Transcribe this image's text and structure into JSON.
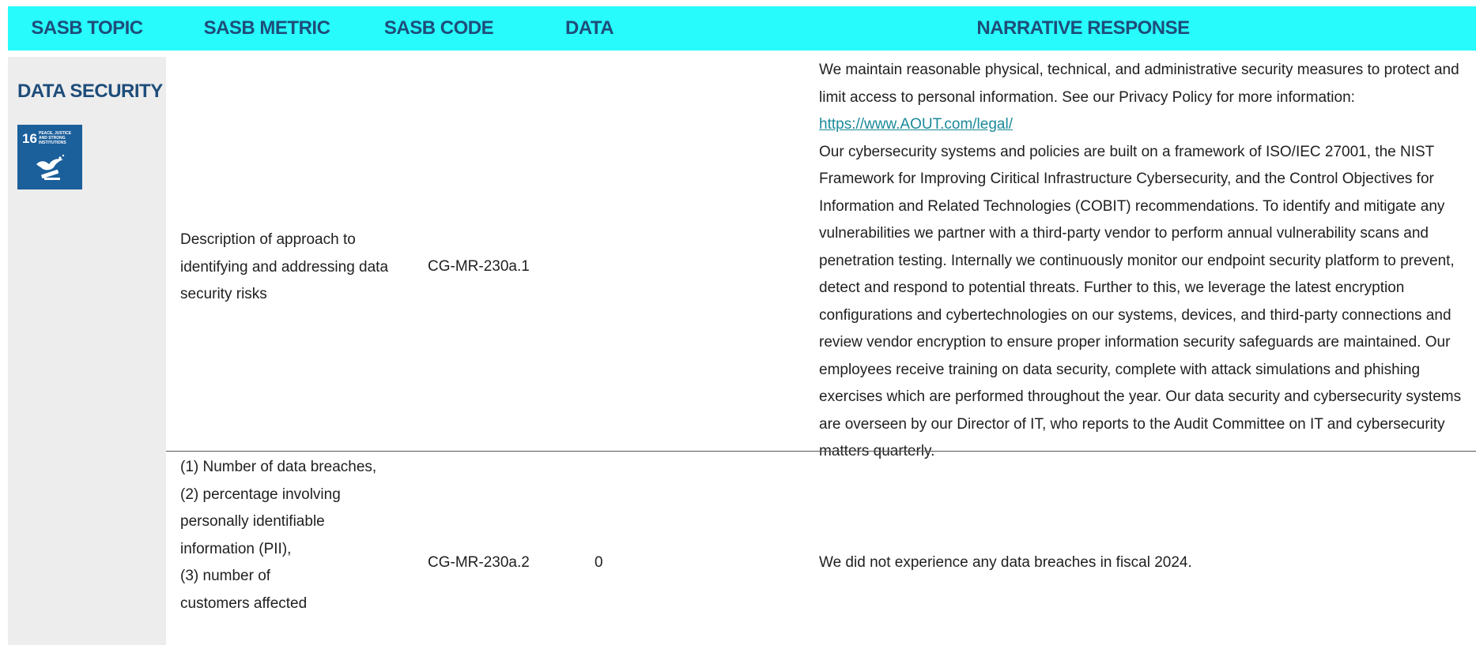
{
  "header": {
    "topic": "SASB TOPIC",
    "metric": "SASB METRIC",
    "code": "SASB CODE",
    "data": "DATA",
    "narrative": "NARRATIVE RESPONSE"
  },
  "topic": {
    "title": "DATA SECURITY",
    "sdg_badge": {
      "number": "16",
      "caption": "PEACE, JUSTICE AND STRONG INSTITUTIONS",
      "icon": "dove-gavel-icon",
      "color": "#1b5f9b"
    }
  },
  "rows": [
    {
      "metric": "Description of approach to identifying and addressing data security risks",
      "code": "CG-MR-230a.1",
      "data": "",
      "narrative_p1": "We maintain reasonable physical, technical, and administrative security measures to protect and limit access to personal information. See our Privacy Policy for more information:",
      "narrative_link": "https://www.AOUT.com/legal/",
      "narrative_p2": "Our cybersecurity systems and policies are built on a framework of ISO/IEC 27001, the NIST Framework for Improving Ciritical Infrastructure Cybersecurity, and the Control Objectives for Information and Related Technologies (COBIT) recommendations. To identify and mitigate any vulnerabilities we partner with a third-party vendor to perform annual vulnerability scans and penetration testing. Internally we continuously monitor our endpoint security platform to prevent, detect and respond to potential threats. Further to this, we leverage the latest encryption configurations and cybertechnologies on our systems, devices, and third-party connections and review vendor encryption to ensure proper information security safeguards are maintained. Our employees receive training on data security, complete with attack simulations and phishing exercises which are performed throughout the year. Our data security and cybersecurity systems are overseen by our Director of IT, who reports to the Audit Committee on IT and cybersecurity matters quarterly."
    },
    {
      "metric_lines": [
        "(1) Number of data breaches,",
        "(2) percentage involving",
        "personally identifiable",
        "information (PII),",
        "(3) number of",
        "customers affected"
      ],
      "code": "CG-MR-230a.2",
      "data": "0",
      "narrative": "We did not experience any data breaches in fiscal 2024."
    }
  ],
  "colors": {
    "header_bg": "#27fbfb",
    "header_text": "#1e4d7a",
    "topic_bg": "#ededed",
    "link": "#1a8a9a"
  }
}
